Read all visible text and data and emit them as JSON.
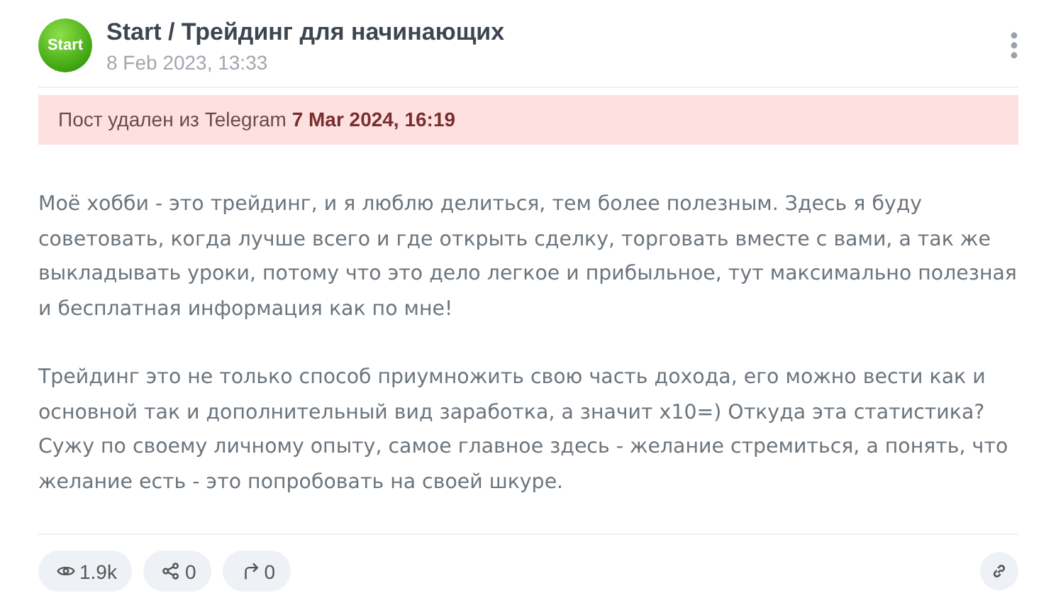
{
  "post": {
    "avatar": "Start",
    "title": "Start / Трейдинг для начинающих",
    "date": "8 Feb 2023, 13:33"
  },
  "notice": "Пост удален из Telegram **7 Mar 2024, 16:19**",
  "body": [
    "Моё хобби - это трейдинг, и я люблю делиться, тем более полезным. Здесь я буду советовать, когда лучше всего и где открыть сделку, торговать вместе с вами, а так же выкладывать уроки, потому что это дело легкое и прибыльное, тут максимально полезная и бесплатная информация как по мне!",
    "Трейдинг это не только способ приумножить свою часть дохода, его можно вести как и основной так и дополнительный вид заработка, а значит х10=) Откуда эта статистика? Сужу по своему личному опыту, самое главное здесь - желание стремиться, а понять, что желание есть - это попробовать на своей шкуре."
  ],
  "stats": [
    {
      "kind": "views",
      "value": "1.9k"
    },
    {
      "kind": "shares",
      "value": "0"
    },
    {
      "kind": "forwards",
      "value": "0"
    }
  ]
}
